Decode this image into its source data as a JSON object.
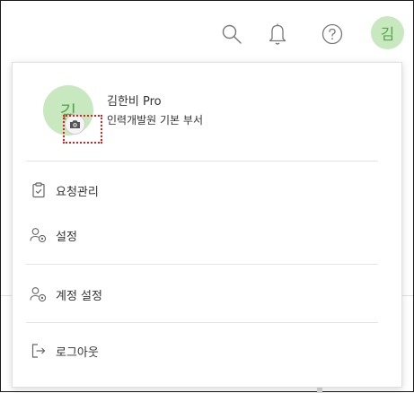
{
  "header": {
    "avatar_text": "김"
  },
  "icons": {
    "search": "search-icon",
    "notification": "bell-icon",
    "help": "help-icon",
    "camera": "camera-icon"
  },
  "profile": {
    "avatar_text": "김",
    "name": "김한비 Pro",
    "department": "인력개발원 기본 부서"
  },
  "menu": {
    "request_management": "요청관리",
    "settings": "설정",
    "account_settings": "계정 설정",
    "logout": "로그아웃"
  },
  "colors": {
    "avatar_bg": "#c8e8c0",
    "avatar_text": "#58a64a",
    "highlight": "#e0201b",
    "icon_gray": "#777777"
  }
}
